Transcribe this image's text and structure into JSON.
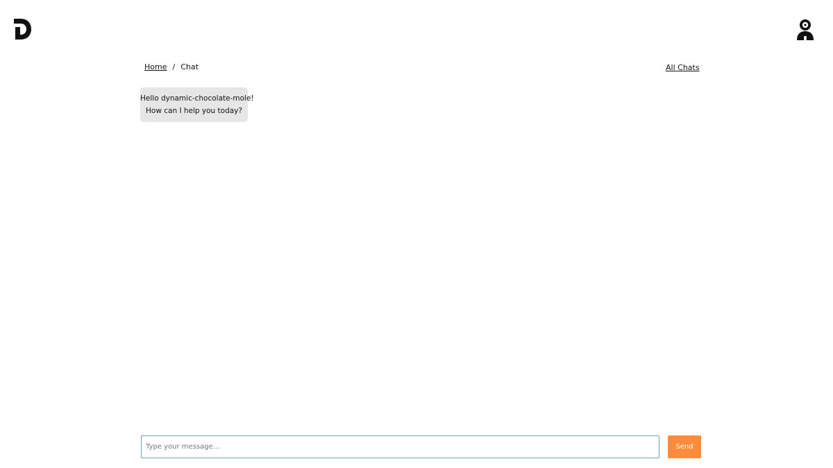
{
  "header": {
    "logo_icon": "d-logo-icon",
    "avatar_icon": "user-avatar-icon"
  },
  "breadcrumb": {
    "home": "Home",
    "separator": "/",
    "current": "Chat"
  },
  "nav": {
    "all_chats": "All Chats"
  },
  "chat": {
    "messages": [
      {
        "line1": "Hello dynamic-chocolate-mole!",
        "line2": "How can I help you today?"
      }
    ]
  },
  "composer": {
    "placeholder": "Type your message...",
    "value": "",
    "send_label": "Send"
  },
  "colors": {
    "accent": "#ff8c3a",
    "bubble": "#e6e6e6",
    "input_border": "#6f9fb6"
  }
}
